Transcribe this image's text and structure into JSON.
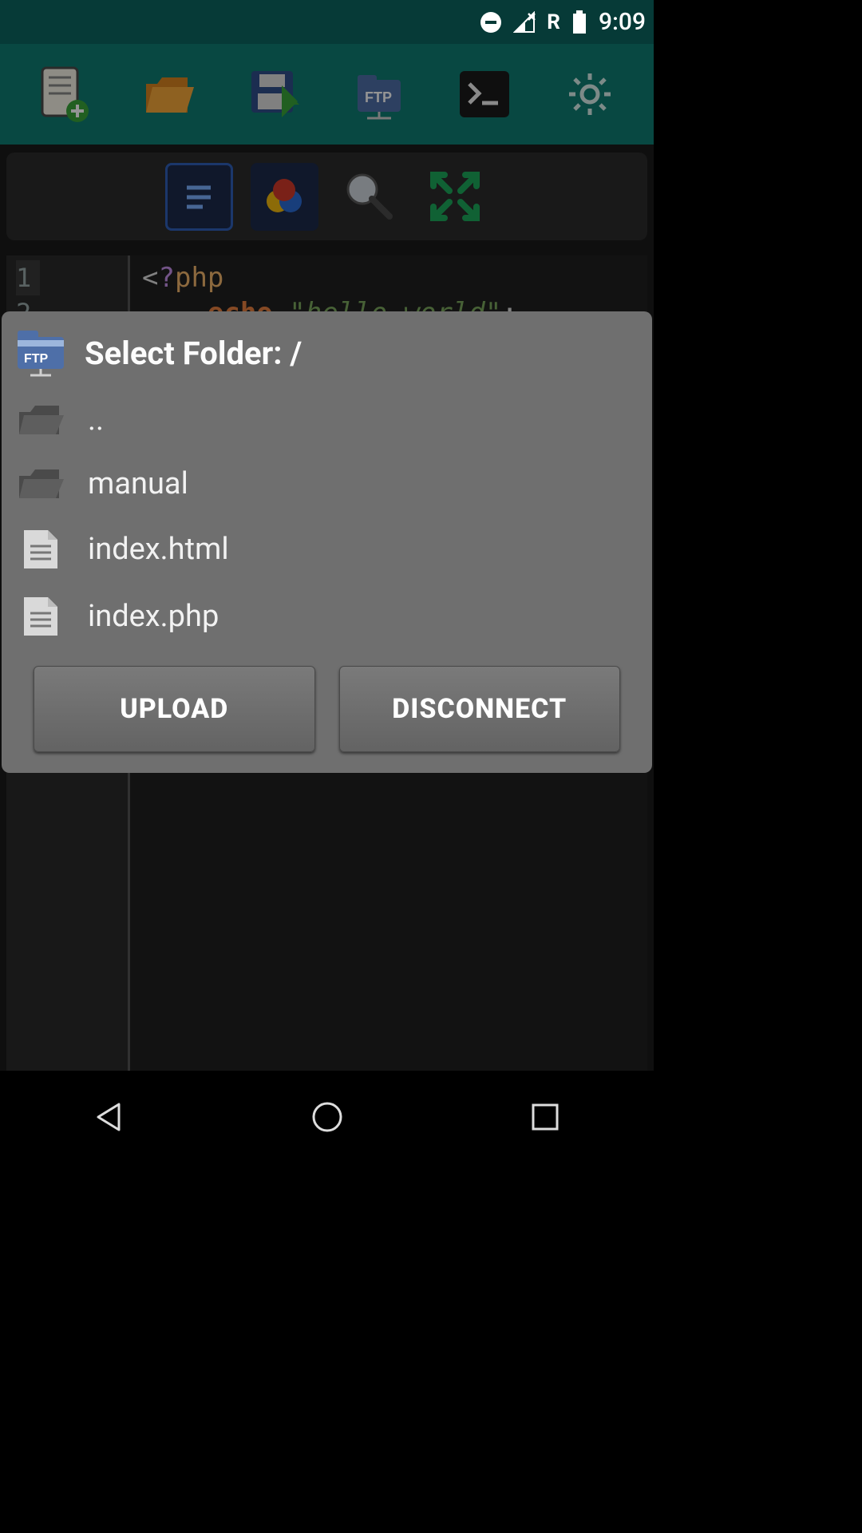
{
  "status": {
    "time": "9:09",
    "network_label": "R"
  },
  "toolbar": {
    "icons": [
      "new-file",
      "open-folder",
      "save",
      "ftp",
      "terminal",
      "settings"
    ]
  },
  "second_row": {
    "icons": [
      "editor-tools",
      "color-picker",
      "search",
      "fullscreen"
    ]
  },
  "code": {
    "line1": {
      "open": "<",
      "qmark": "?",
      "php": "php"
    },
    "line2": {
      "indent": "    ",
      "keyword": "echo",
      "space": " ",
      "string": "\"hello world\"",
      "semi": ";"
    },
    "gutter": [
      "1",
      "2"
    ]
  },
  "dialog": {
    "title": "Select Folder: /",
    "items": [
      {
        "type": "folder",
        "name": ".."
      },
      {
        "type": "folder",
        "name": "manual"
      },
      {
        "type": "file",
        "name": "index.html"
      },
      {
        "type": "file",
        "name": "index.php"
      }
    ],
    "upload_label": "UPLOAD",
    "disconnect_label": "DISCONNECT"
  }
}
